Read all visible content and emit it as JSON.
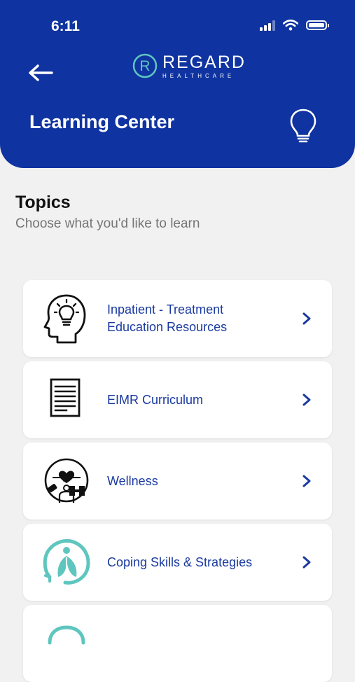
{
  "status_bar": {
    "time": "6:11"
  },
  "header": {
    "logo_main": "REGARD",
    "logo_sub": "HEALTHCARE",
    "title": "Learning Center"
  },
  "section": {
    "title": "Topics",
    "subtitle": "Choose what you'd like to learn"
  },
  "topics": [
    {
      "label": "Inpatient - Treatment Education Resources",
      "icon": "head-lightbulb-icon"
    },
    {
      "label": "EIMR Curriculum",
      "icon": "document-list-icon"
    },
    {
      "label": "Wellness",
      "icon": "wellness-icon"
    },
    {
      "label": "Coping Skills & Strategies",
      "icon": "coping-leaf-icon"
    }
  ],
  "colors": {
    "header_blue": "#0f33a0",
    "link_blue": "#1a3aa0",
    "teal": "#5fc6bf"
  }
}
